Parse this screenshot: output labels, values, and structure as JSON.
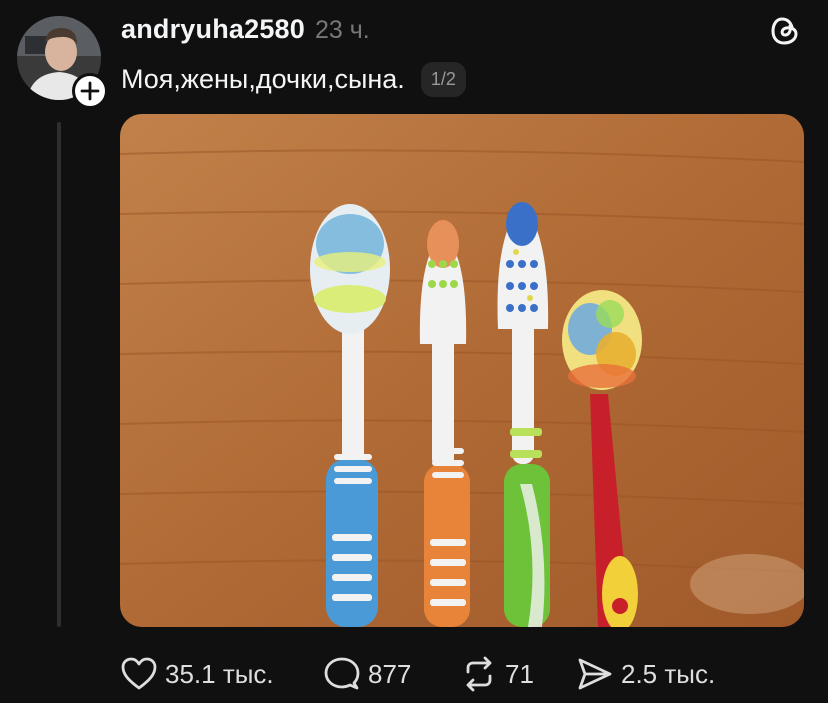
{
  "post": {
    "username": "andryuha2580",
    "timestamp": "23 ч.",
    "caption": "Моя,жены,дочки,сына.",
    "page_counter": "1/2"
  },
  "actions": {
    "likes": "35.1 тыс.",
    "replies": "877",
    "reposts": "71",
    "shares": "2.5 тыс."
  },
  "icons": {
    "avatar": "user-avatar-photo",
    "follow": "plus-icon",
    "logo": "threads-logo-icon",
    "like": "heart-icon",
    "reply": "comment-icon",
    "repost": "repost-icon",
    "share": "send-icon"
  },
  "colors": {
    "background": "#101010",
    "text_primary": "#f3f5f7",
    "text_secondary": "#777777",
    "counter_bg": "#262626"
  }
}
